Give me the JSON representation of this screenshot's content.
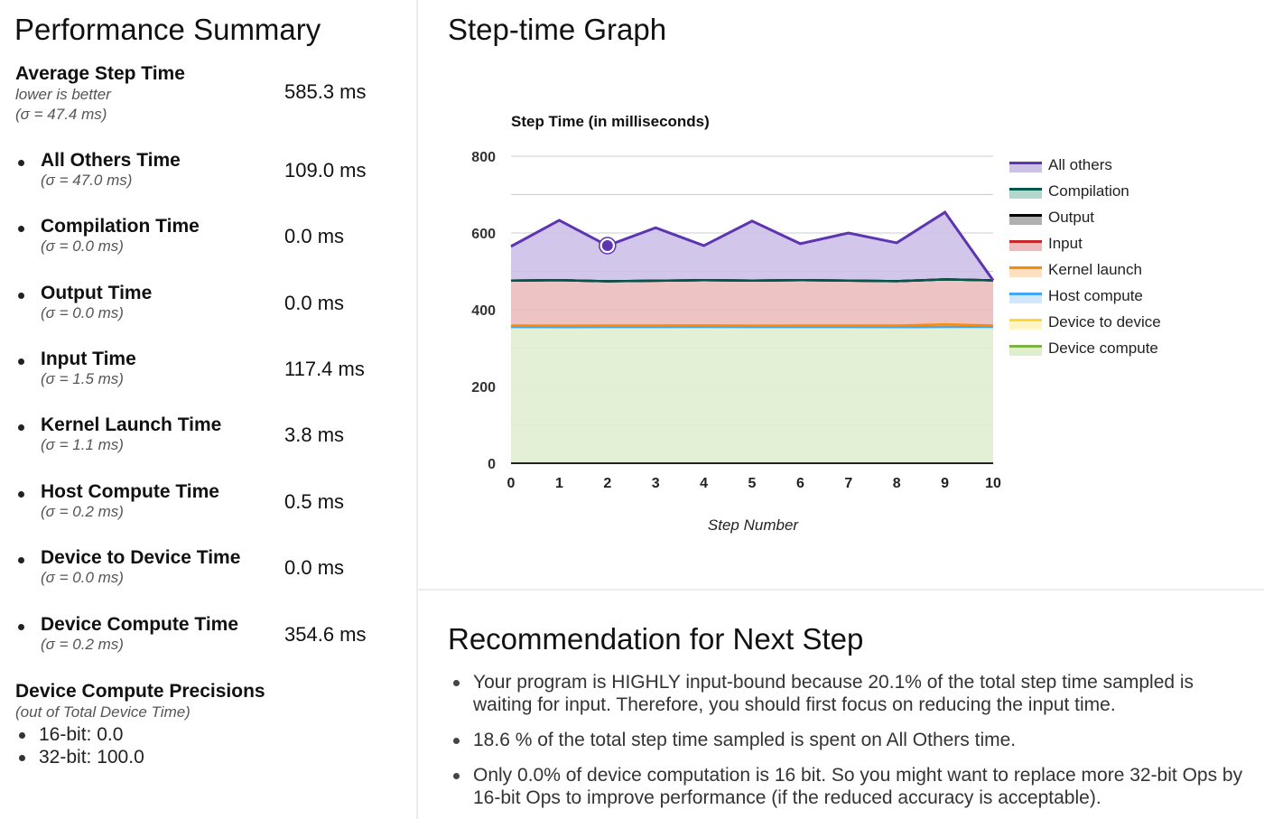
{
  "summary": {
    "title": "Performance Summary",
    "average": {
      "label": "Average Step Time",
      "note": "lower is better",
      "sigma": "(σ = 47.4 ms)",
      "value": "585.3 ms"
    },
    "metrics": [
      {
        "label": "All Others Time",
        "sigma": "(σ = 47.0 ms)",
        "value": "109.0 ms"
      },
      {
        "label": "Compilation Time",
        "sigma": "(σ = 0.0 ms)",
        "value": "0.0 ms"
      },
      {
        "label": "Output Time",
        "sigma": "(σ = 0.0 ms)",
        "value": "0.0 ms"
      },
      {
        "label": "Input Time",
        "sigma": "(σ = 1.5 ms)",
        "value": "117.4 ms"
      },
      {
        "label": "Kernel Launch Time",
        "sigma": "(σ = 1.1 ms)",
        "value": "3.8 ms"
      },
      {
        "label": "Host Compute Time",
        "sigma": "(σ = 0.2 ms)",
        "value": "0.5 ms"
      },
      {
        "label": "Device to Device Time",
        "sigma": "(σ = 0.0 ms)",
        "value": "0.0 ms"
      },
      {
        "label": "Device Compute Time",
        "sigma": "(σ = 0.2 ms)",
        "value": "354.6 ms"
      }
    ],
    "precisions": {
      "label": "Device Compute Precisions",
      "note": "(out of Total Device Time)",
      "items": [
        "16-bit: 0.0",
        "32-bit: 100.0"
      ]
    }
  },
  "graph": {
    "title": "Step-time Graph"
  },
  "chart_data": {
    "type": "area",
    "stacked": true,
    "title": "Step Time (in milliseconds)",
    "xlabel": "Step Number",
    "ylabel": "",
    "x": [
      0,
      1,
      2,
      3,
      4,
      5,
      6,
      7,
      8,
      9,
      10
    ],
    "xticks": [
      "0",
      "1",
      "2",
      "3",
      "4",
      "5",
      "6",
      "7",
      "8",
      "9",
      "10"
    ],
    "yticks": [
      "0",
      "200",
      "400",
      "600",
      "800"
    ],
    "ylim": [
      0,
      800
    ],
    "grid": true,
    "legend_position": "right",
    "highlighted_point": {
      "series": "All others",
      "x": 2
    },
    "series": [
      {
        "name": "Device compute",
        "line_color": "#7cb342",
        "fill_color": "#e0eed0",
        "values": [
          354.6,
          354.5,
          354.6,
          354.6,
          354.7,
          354.6,
          354.6,
          354.6,
          354.5,
          354.6,
          354.6
        ]
      },
      {
        "name": "Device to device",
        "line_color": "#fdd835",
        "fill_color": "#fff5c4",
        "values": [
          0,
          0,
          0,
          0,
          0,
          0,
          0,
          0,
          0,
          0,
          0
        ]
      },
      {
        "name": "Host compute",
        "line_color": "#42a5f5",
        "fill_color": "#d2e7fb",
        "values": [
          0.5,
          0.5,
          0.5,
          0.5,
          0.5,
          0.5,
          0.5,
          0.5,
          0.5,
          0.6,
          0.6
        ]
      },
      {
        "name": "Kernel launch",
        "line_color": "#fb8c00",
        "fill_color": "#fde0c2",
        "values": [
          3.6,
          3.5,
          3.6,
          3.7,
          3.9,
          3.5,
          3.6,
          3.7,
          3.8,
          6.5,
          3.6
        ]
      },
      {
        "name": "Input",
        "line_color": "#c62828",
        "fill_color": "#ebbcbc",
        "values": [
          117.3,
          118.5,
          115.3,
          116.8,
          117.9,
          117.4,
          118.3,
          117.2,
          115.5,
          117.3,
          117.6
        ]
      },
      {
        "name": "Output",
        "line_color": "#000000",
        "fill_color": "#b0b0b0",
        "values": [
          0,
          0,
          0,
          0,
          0,
          0,
          0,
          0,
          0,
          0,
          0
        ]
      },
      {
        "name": "Compilation",
        "line_color": "#00574b",
        "fill_color": "#b3d6cf",
        "values": [
          0,
          0,
          0,
          0,
          0,
          0,
          0,
          0,
          0,
          0,
          0
        ]
      },
      {
        "name": "All others",
        "line_color": "#5e35b1",
        "fill_color": "#cdc1e8",
        "values": [
          89,
          156,
          93,
          138,
          90,
          155,
          95,
          124,
          100,
          175,
          0
        ]
      }
    ],
    "legend_order": [
      "All others",
      "Compilation",
      "Output",
      "Input",
      "Kernel launch",
      "Host compute",
      "Device to device",
      "Device compute"
    ]
  },
  "recommendation": {
    "title": "Recommendation for Next Step",
    "items": [
      "Your program is HIGHLY input-bound because 20.1% of the total step time sampled is waiting for input. Therefore, you should first focus on reducing the input time.",
      "18.6 % of the total step time sampled is spent on All Others time.",
      "Only 0.0% of device computation is 16 bit. So you might want to replace more 32-bit Ops by 16-bit Ops to improve performance (if the reduced accuracy is acceptable)."
    ]
  }
}
